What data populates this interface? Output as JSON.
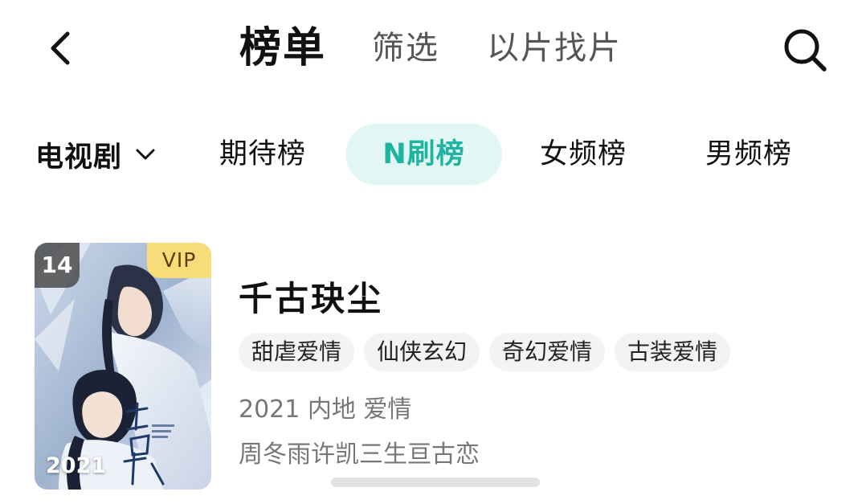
{
  "header": {
    "back_icon": "chevron-left-icon",
    "tabs": [
      {
        "label": "榜单",
        "active": true
      },
      {
        "label": "筛选",
        "active": false
      },
      {
        "label": "以片找片",
        "active": false
      }
    ],
    "search_icon": "search-icon"
  },
  "category_row": {
    "dropdown_label": "电视剧",
    "dropdown_icon": "chevron-down-icon",
    "tabs": [
      {
        "label": "期待榜",
        "active": false
      },
      {
        "label": "N刷榜",
        "active": true
      },
      {
        "label": "女频榜",
        "active": false
      },
      {
        "label": "男频榜",
        "active": false
      }
    ],
    "active_color": "#1fb3a1",
    "active_bg": "#e2f7f4"
  },
  "card": {
    "rank": "14",
    "vip_label": "VIP",
    "poster_year": "2021",
    "title": "千古玦尘",
    "tags": [
      "甜虐爱情",
      "仙侠玄幻",
      "奇幻爱情",
      "古装爱情"
    ],
    "meta": "2021 内地 爱情",
    "description": "周冬雨许凯三生亘古恋",
    "vip_color": "#f7dc7a"
  }
}
